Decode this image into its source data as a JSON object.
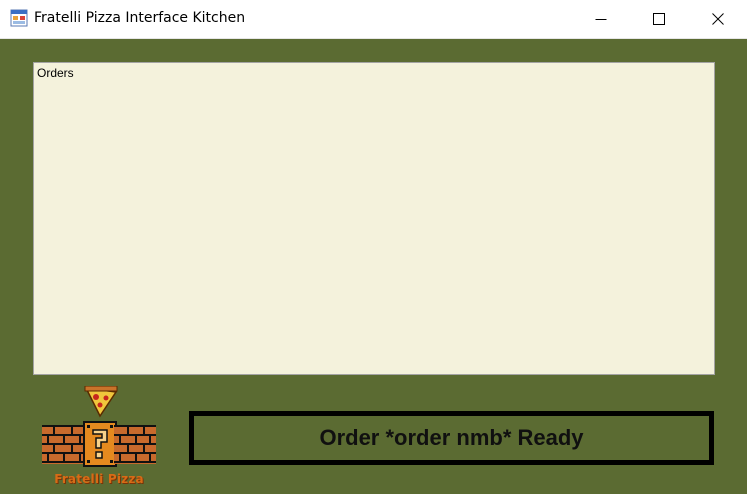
{
  "window": {
    "title": "Fratelli Pizza Interface Kitchen",
    "icon": "form-icon",
    "controls": [
      "minimize-icon",
      "maximize-icon",
      "close-icon"
    ]
  },
  "orders": {
    "label": "Orders",
    "items": []
  },
  "logo": {
    "text": "Fratelli Pizza",
    "icon": "pizza-brick-logo"
  },
  "status": {
    "text": "Order *order nmb* Ready"
  },
  "colors": {
    "background": "#5b6b32",
    "orders_panel": "#f4f2dc",
    "status_border": "#000000",
    "logo_text": "#d76b16"
  }
}
